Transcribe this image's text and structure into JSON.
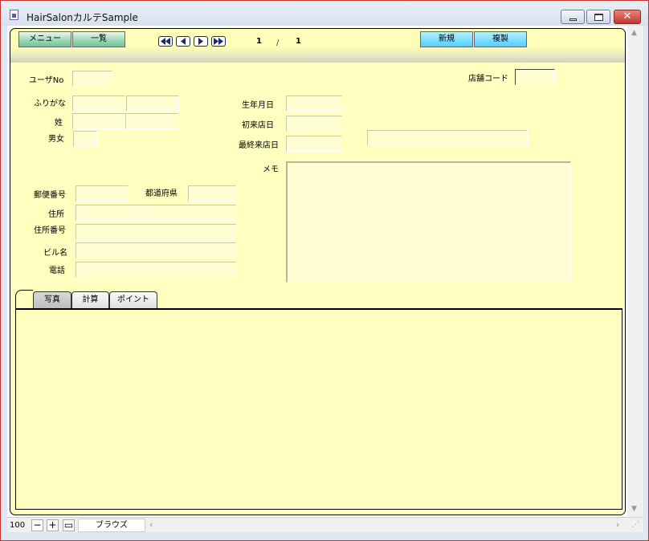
{
  "window": {
    "title": "HairSalonカルテSample",
    "close": "✕"
  },
  "header": {
    "menu_label": "メニュー",
    "list_label": "一覧",
    "new_label": "新規",
    "copy_label": "複製",
    "record_current": "1",
    "record_sep": "/",
    "record_total": "1"
  },
  "form": {
    "user_no_label": "ユーザNo",
    "store_code_label": "店舗コード",
    "furigana_label": "ふりがな",
    "surname_label": "姓",
    "gender_label": "男女",
    "birthdate_label": "生年月日",
    "first_visit_label": "初来店日",
    "last_visit_label": "最終来店日",
    "memo_label": "メモ",
    "postal_label": "郵便番号",
    "prefecture_label": "都道府県",
    "address_label": "住所",
    "address_no_label": "住所番号",
    "building_label": "ビル名",
    "phone_label": "電話"
  },
  "tabs": [
    {
      "label": "写真",
      "active": true
    },
    {
      "label": "計算",
      "active": false
    },
    {
      "label": "ポイント",
      "active": false
    }
  ],
  "statusbar": {
    "zoom": "100",
    "mode": "ブラウズ"
  },
  "colors": {
    "layout_bg": "#ffffbf",
    "field_bg": "#fefed2",
    "green_button": "#6cc594",
    "cyan_button": "#4fd0ff"
  }
}
